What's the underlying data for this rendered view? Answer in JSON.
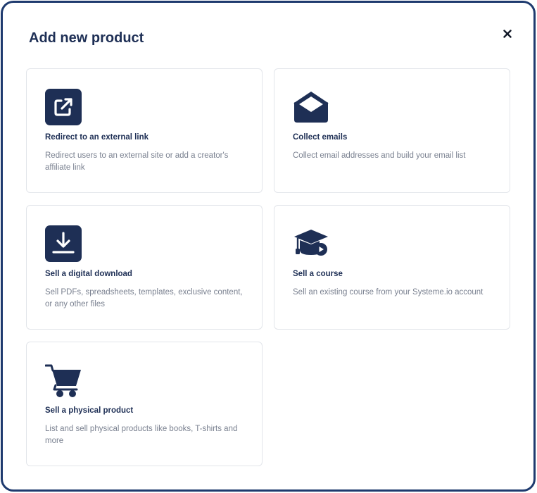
{
  "modal": {
    "title": "Add new product",
    "close_icon": "close-icon"
  },
  "cards": [
    {
      "id": "external-link",
      "icon": "external-link-icon",
      "title": "Redirect to an external link",
      "description": "Redirect users to an external site or add a creator's affiliate link"
    },
    {
      "id": "collect-emails",
      "icon": "envelope-icon",
      "title": "Collect emails",
      "description": "Collect email addresses and build your email list"
    },
    {
      "id": "digital-download",
      "icon": "download-icon",
      "title": "Sell a digital download",
      "description": "Sell PDFs, spreadsheets, templates, exclusive content, or any other files"
    },
    {
      "id": "course",
      "icon": "graduation-cap-icon",
      "title": "Sell a course",
      "description": "Sell an existing course from your Systeme.io account"
    },
    {
      "id": "physical-product",
      "icon": "shopping-cart-icon",
      "title": "Sell a physical product",
      "description": "List and sell physical products like books, T-shirts and more"
    }
  ],
  "colors": {
    "primary": "#1e2f55",
    "frame_border": "#1e3a6e",
    "card_border": "#e2e5ea",
    "muted_text": "#7a8190"
  }
}
